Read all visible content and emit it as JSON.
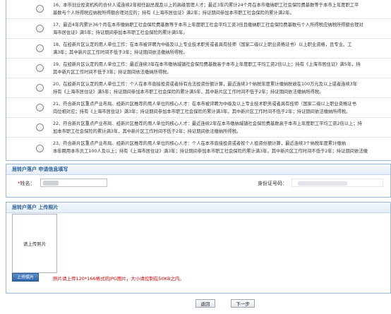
{
  "options": [
    {
      "lines": [
        "16、本市创业投资机构的合伙人或连续2年担任副总裁及以上的高级管理人才；最近3年内累计24个月在本市缴纳职工社会保险费基数等于本市上年度职工平",
        "基数与个人所得税应纳税所得额合理对应的；持有《上海市居住证》满2年；持证期间参加本市职工社会保险的累计满2年。"
      ]
    },
    {
      "lines": [
        "17、最近4年内累计36个月在本市缴纳职工社会保险费基数等于本市上年度职工社会平均工资3倍且缴纳职工社会保险费基数与个人所得税应纳税所得额合理对",
        "海市居住证》满5年；持证期间参加本市职工社会保险的累计满5年。"
      ]
    },
    {
      "lines": [
        "18、在经新片区认定的用人单位工作：在本市被评聘为中级及以上专业技术职务或者具有技师（国家二级以上职业资格证书）以上职业资格，且专业、工",
        "满3年；其中新片区工作时间不低于3年；持证期间依法缴纳所得税。"
      ]
    },
    {
      "lines": [
        "19、在经新片区认定的用人单位工作：最近连续3年在本市缴纳城镇社会保险费基数高于本市上年度职工平均工资2倍以上；持有《上海市居住证》满5年，持",
        "其中新片区工作时间不低于3年；持证期间依法缴纳所得税。"
      ]
    },
    {
      "lines": [
        "20、在经新片区认定的用人单位工作：个人在本市直接投资或者持有合法投资份额计算，最近连续3个纳税年度累计缴纳税收在100万元及以上或者连续3年",
        "持有《上海市居住证》满5年；持证期间参加本市职工社会保险的累计满5年，其中新片区工作时间不低于2年；持证期间依法缴纳所得税。"
      ]
    },
    {
      "lines": [
        "21、符合新片区重点产业布局、经新片区推荐的用人单位的核心人才：在本市被评聘为中级及以上专业技术职务或者具有技师（国家二级以上职业资格证书",
        "岗位相对应；持有《上海市居住证》满3年；持证期间参加本市职工社会保险的累计满3年，其中新片区工作时间不低于2年；持证期间依法缴纳所得税。"
      ]
    },
    {
      "lines": [
        "22、符合新片区重点产业布局、经新片区推荐的用人单位的核心人才：最近连续2年在本市缴纳城镇社会保险费基数高于本市上年度职工平均工资2倍以上；持",
        "加本市职工社会保险的累计满3年，其中新片区工作时间不低于2年；持证期间依法缴纳所得税。"
      ]
    },
    {
      "lines": [
        "23、符合新片区重点产业布局、经新片区推荐的用人单位的核心人才：个人在本市直接投资或者按个人投资份额计算，最近连续3个纳税年度累计缴纳",
        "本年聘用本市员工100人及以上；持有《上海市居住证》满3年；持证期间参加本市职工社会保险的累计满3年，其中新片区工作时间不低于2年；持证期间依法缴"
      ]
    }
  ],
  "applicant_section": {
    "title": "居转户落户 申请信息填写",
    "name_required": "*",
    "name_label": "姓名：",
    "id_label": "身份证号码："
  },
  "photo_section": {
    "title": "居转户落户 上传照片",
    "photo_placeholder": "请上传照片",
    "upload_button": "上传照片",
    "hint": "照片请上传120*166格式的JPG图片，大小请控制在50KB之内。"
  },
  "navigation": {
    "back_button": "返回",
    "next_button": "下一步"
  },
  "colors": {
    "panel_border": "#9ab7d6",
    "section_title": "#2b5f9e",
    "hint_red": "#d40000",
    "upload_button": "#2f66a8"
  }
}
